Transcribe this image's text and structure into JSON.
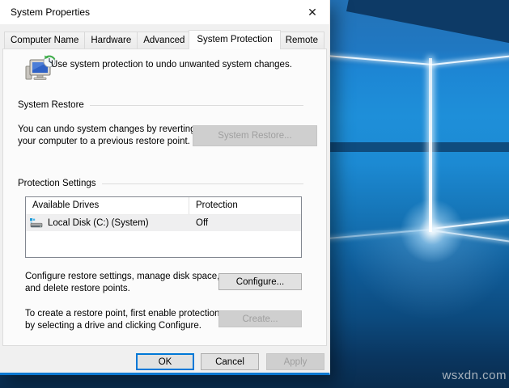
{
  "window": {
    "title": "System Properties"
  },
  "icons": {
    "close_icon": "✕",
    "system_protection_icon": "computer-with-restore-clock",
    "drive_icon": "hard-drive-system"
  },
  "tabs": [
    {
      "label": "Computer Name",
      "active": false
    },
    {
      "label": "Hardware",
      "active": false
    },
    {
      "label": "Advanced",
      "active": false
    },
    {
      "label": "System Protection",
      "active": true
    },
    {
      "label": "Remote",
      "active": false
    }
  ],
  "page": {
    "header_text": "Use system protection to undo unwanted system changes."
  },
  "system_restore": {
    "group_label": "System Restore",
    "desc_line1": "You can undo system changes by reverting",
    "desc_line2": "your computer to a previous restore point.",
    "button_label": "System Restore...",
    "button_enabled": false
  },
  "protection": {
    "group_label": "Protection Settings",
    "table": {
      "columns": [
        "Available Drives",
        "Protection"
      ],
      "rows": [
        {
          "drive": "Local Disk (C:) (System)",
          "protection": "Off",
          "selected": true
        }
      ]
    },
    "configure_desc_line1": "Configure restore settings, manage disk space,",
    "configure_desc_line2": "and delete restore points.",
    "configure_button": "Configure...",
    "create_desc_line1": "To create a restore point, first enable protection",
    "create_desc_line2": "by selecting a drive and clicking Configure.",
    "create_button": "Create...",
    "create_enabled": false
  },
  "footer": {
    "ok": "OK",
    "cancel": "Cancel",
    "apply": "Apply",
    "apply_enabled": false
  },
  "desktop": {
    "watermark": "wsxdn.com"
  },
  "colors": {
    "accent": "#0078d7",
    "dialog_bg": "#f0f0f0",
    "page_bg": "#fbfbfb",
    "title_bar": "#ffffff",
    "selected_row": "#efeff0",
    "wallpaper_mid": "#1e8fd9",
    "wallpaper_dark": "#092c4e"
  }
}
